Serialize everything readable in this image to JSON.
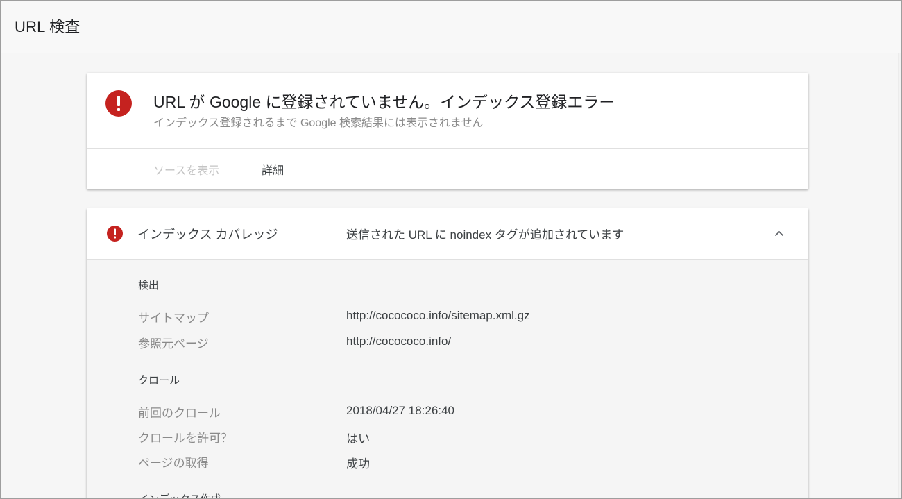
{
  "header": {
    "title": "URL 検査"
  },
  "status_card": {
    "icon": "error-icon",
    "title": "URL が Google に登録されていません。インデックス登録エラー",
    "subtitle": "インデックス登録されるまで Google 検索結果には表示されません",
    "actions": {
      "view_source": "ソースを表示",
      "details": "詳細"
    }
  },
  "coverage": {
    "icon": "error-icon",
    "label": "インデックス カバレッジ",
    "status": "送信された URL に noindex タグが追加されています",
    "collapse_icon": "chevron-up-icon",
    "sections": [
      {
        "heading": "検出",
        "rows": [
          {
            "label": "サイトマップ",
            "value": "http://cocococo.info/sitemap.xml.gz"
          },
          {
            "label": "参照元ページ",
            "value": "http://cocococo.info/"
          }
        ]
      },
      {
        "heading": "クロール",
        "rows": [
          {
            "label": "前回のクロール",
            "value": "2018/04/27 18:26:40"
          },
          {
            "label": "クロールを許可？",
            "value": "はい"
          },
          {
            "label": "ページの取得",
            "value": "成功"
          }
        ]
      },
      {
        "heading": "インデックス作成",
        "rows": []
      }
    ]
  },
  "colors": {
    "error": "#c5221f",
    "background": "#f5f5f5",
    "card": "#ffffff",
    "muted_text": "#8a8a8a",
    "disabled_text": "#c4c4c4"
  }
}
